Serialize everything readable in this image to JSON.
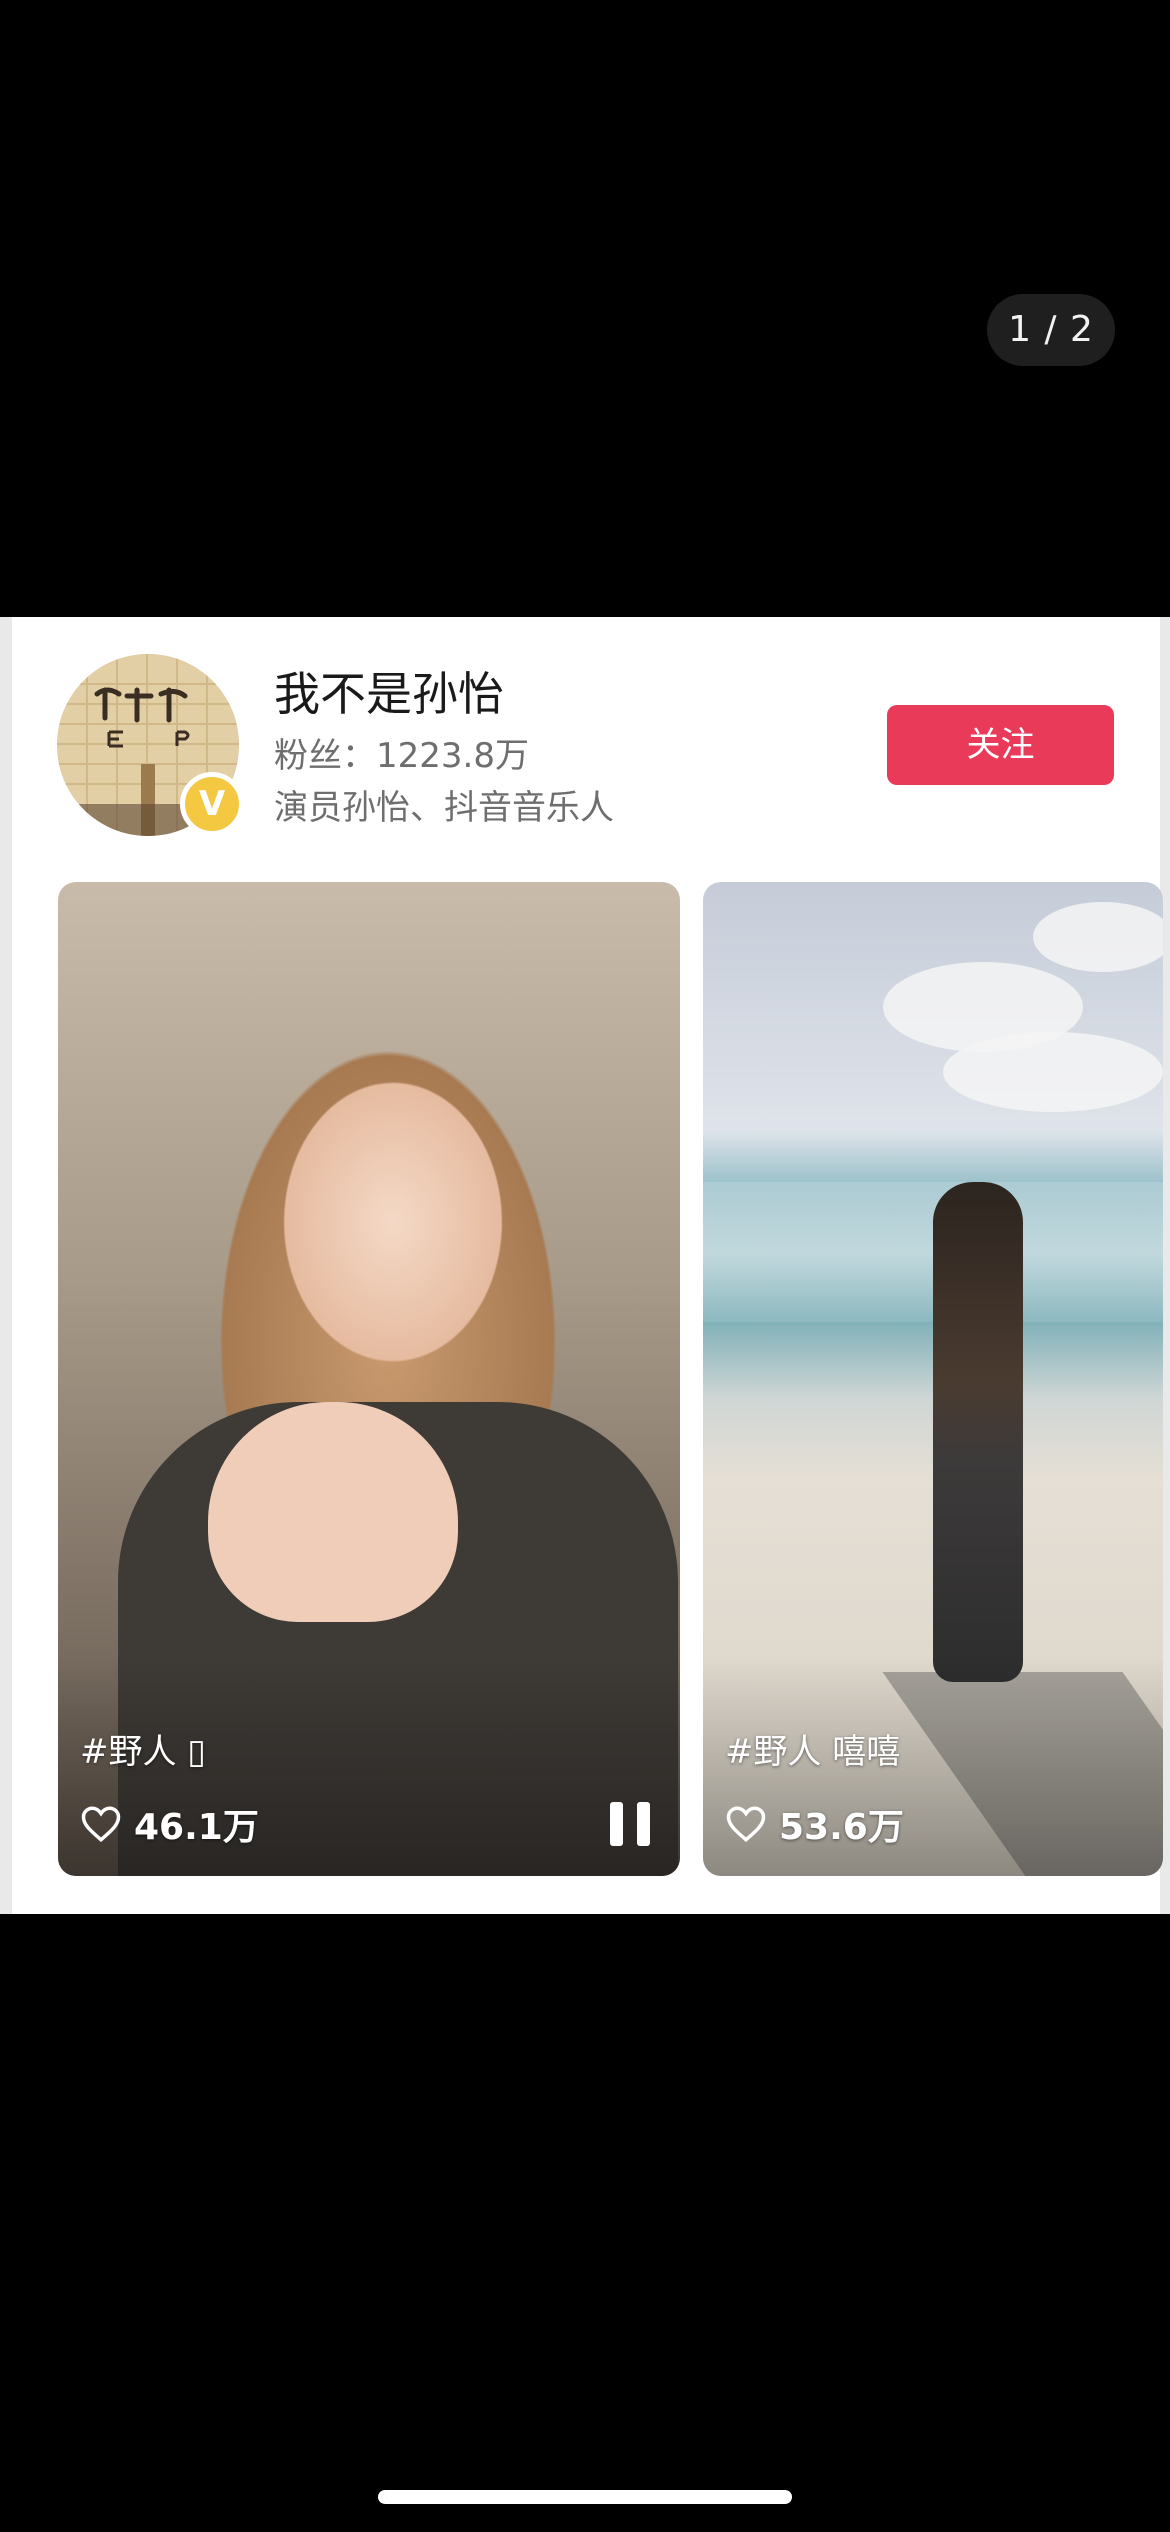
{
  "viewer": {
    "page_indicator": "1 / 2"
  },
  "profile": {
    "username": "我不是孙怡",
    "fans": "粉丝：1223.8万",
    "bio": "演员孙怡、抖音音乐人",
    "verified_badge": "V",
    "follow_label": "关注",
    "follow_color": "#ea3a5a"
  },
  "videos": [
    {
      "caption": "#野人 ▯",
      "likes": "46.1万",
      "state": "playing"
    },
    {
      "caption": "#野人 嘻嘻",
      "likes": "53.6万"
    }
  ]
}
